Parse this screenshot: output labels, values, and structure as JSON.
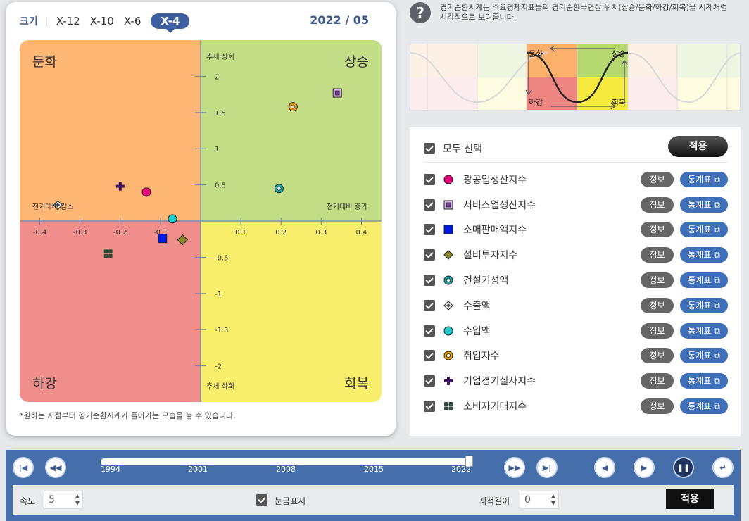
{
  "size_selector": {
    "label": "크기",
    "options": [
      "X-12",
      "X-10",
      "X-6",
      "X-4"
    ],
    "selected": "X-4"
  },
  "current_period": "2022 / 05",
  "quadrants": {
    "top_left": "둔화",
    "top_right": "상승",
    "bottom_left": "하강",
    "bottom_right": "회복"
  },
  "axis": {
    "top_label": "추세 상회",
    "bottom_label": "추세 하회",
    "left_label": "전기대비 감소",
    "right_label": "전기대비 증가",
    "x_ticks": [
      "-0.4",
      "-0.3",
      "-0.2",
      "-0.1",
      "0.1",
      "0.2",
      "0.3",
      "0.4"
    ],
    "y_ticks": [
      "2",
      "1.5",
      "1",
      "0.5",
      "-0.5",
      "-1",
      "-1.5",
      "-2"
    ]
  },
  "chart_data": {
    "type": "scatter",
    "xlim": [
      -0.45,
      0.45
    ],
    "ylim": [
      -2.5,
      2.5
    ],
    "points": [
      {
        "name": "광공업생산지수",
        "x": -0.135,
        "y": 0.4,
        "marker": "circle",
        "color": "#e6007e"
      },
      {
        "name": "서비스업생산지수",
        "x": 0.34,
        "y": 1.77,
        "marker": "square-outline",
        "color": "#7a3f9d"
      },
      {
        "name": "소매판매액지수",
        "x": -0.095,
        "y": -0.24,
        "marker": "square",
        "color": "#0018e8"
      },
      {
        "name": "설비투자지수",
        "x": -0.045,
        "y": -0.26,
        "marker": "diamond",
        "color": "#8c8a2a"
      },
      {
        "name": "건설기성액",
        "x": 0.195,
        "y": 0.45,
        "marker": "circle-ring",
        "color": "#1fa7a7"
      },
      {
        "name": "수출액",
        "x": -0.355,
        "y": 0.22,
        "marker": "diamond-outline",
        "color": "#555555"
      },
      {
        "name": "수입액",
        "x": -0.07,
        "y": 0.03,
        "marker": "circle",
        "color": "#1ec9c9"
      },
      {
        "name": "취업자수",
        "x": 0.23,
        "y": 1.58,
        "marker": "circle-ring",
        "color": "#f0a000"
      },
      {
        "name": "기업경기실사지수",
        "x": -0.2,
        "y": 0.48,
        "marker": "cross",
        "color": "#3a1460"
      },
      {
        "name": "소비자기대지수",
        "x": -0.23,
        "y": -0.45,
        "marker": "four-squares",
        "color": "#2d4a3a"
      }
    ]
  },
  "note": "*원하는 시점부터 경기순환시계가 돌아가는 모습을 볼 수 있습니다.",
  "help_text": "경기순환시계는 주요경제지표들의 경기순환국면상 위치(상승/둔화/하강/회복)을 시계처럼 시각적으로 보여줍니다.",
  "cycle_diagram": {
    "labels": [
      "둔화",
      "상승",
      "하강",
      "회복"
    ]
  },
  "legend": {
    "select_all": "모두 선택",
    "apply": "적용",
    "info_label": "정보",
    "stat_label": "통계표",
    "items": [
      "광공업생산지수",
      "서비스업생산지수",
      "소매판매액지수",
      "설비투자지수",
      "건설기성액",
      "수출액",
      "수입액",
      "취업자수",
      "기업경기실사지수",
      "소비자기대지수"
    ]
  },
  "timeline": {
    "years": [
      "1994",
      "2001",
      "2008",
      "2015",
      "2022"
    ],
    "position_fraction": 1.0
  },
  "controls": {
    "speed_label": "속도",
    "speed_value": "5",
    "grid_label": "눈금표시",
    "trail_label": "궤적길이",
    "trail_value": "0",
    "apply": "적용"
  },
  "colors": {
    "q_top_left": "#fdb674",
    "q_top_right": "#c2dd86",
    "q_bottom_left": "#f08e8b",
    "q_bottom_right": "#f8ee6c",
    "accent": "#3d5fa0"
  }
}
